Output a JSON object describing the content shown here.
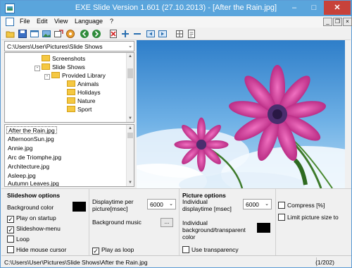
{
  "window": {
    "title": "EXE Slide Version 1.601 (27.10.2013) - [After the Rain.jpg]",
    "minimize": "–",
    "maximize": "□",
    "close": "✕"
  },
  "menu": {
    "items": [
      "File",
      "Edit",
      "View",
      "Language",
      "?"
    ],
    "mdi_controls": [
      "_",
      "❐",
      "×"
    ]
  },
  "toolbar": {
    "icons": [
      "open-icon",
      "save-icon",
      "window-icon",
      "slideshow-icon",
      "export-icon",
      "settings-icon",
      "back-icon",
      "forward-icon",
      "delete-icon",
      "add-icon",
      "remove-icon",
      "previous-icon",
      "next-icon",
      "grid-icon",
      "info-icon"
    ]
  },
  "path": {
    "value": "C:\\Users\\User\\Pictures\\Slide Shows"
  },
  "tree": {
    "items": [
      {
        "label": "Screenshots",
        "level": 1,
        "toggle": ""
      },
      {
        "label": "Slide Shows",
        "level": 1,
        "toggle": "-"
      },
      {
        "label": "Provided Library",
        "level": 2,
        "toggle": "-"
      },
      {
        "label": "Animals",
        "level": 3,
        "toggle": ""
      },
      {
        "label": "Holidays",
        "level": 3,
        "toggle": ""
      },
      {
        "label": "Nature",
        "level": 3,
        "toggle": ""
      },
      {
        "label": "Sport",
        "level": 3,
        "toggle": ""
      }
    ]
  },
  "files": {
    "items": [
      "After the Rain.jpg",
      "AfternoonSun.jpg",
      "Annie.jpg",
      "Arc de Triomphe.jpg",
      "Architecture.jpg",
      "Asleep.jpg",
      "Autumn Leaves.jpg"
    ],
    "selected_index": 0
  },
  "slideshow_options": {
    "heading": "Slideshow options",
    "background_color_label": "Background color",
    "play_on_startup": "Play on startup",
    "slideshow_menu": "Slideshow-menu",
    "loop": "Loop",
    "hide_mouse_cursor": "Hide mouse cursor",
    "displaytime_label": "Displaytime per picture[msec]",
    "displaytime_value": "6000",
    "background_music_label": "Background music",
    "background_music_button": "...",
    "play_as_loop": "Play as loop",
    "checks": {
      "play_on_startup": true,
      "slideshow_menu": true,
      "loop": false,
      "hide_mouse_cursor": false,
      "play_as_loop": true
    }
  },
  "picture_options": {
    "heading": "Picture options",
    "individual_displaytime_label": "Individual displaytime [msec]",
    "individual_displaytime_value": "6000",
    "individual_background_label": "Individual background/transparent color",
    "use_transparency": "Use transparency",
    "compress": "Compress [%]",
    "limit_picture_size": "Limit picture size to",
    "checks": {
      "use_transparency": false,
      "compress": false,
      "limit_picture_size": false
    }
  },
  "status": {
    "path": "C:\\Users\\User\\Pictures\\Slide Shows\\After the Rain.jpg",
    "count": "(1/202)"
  },
  "check_mark": "✓",
  "combo_arrow": "⌄"
}
